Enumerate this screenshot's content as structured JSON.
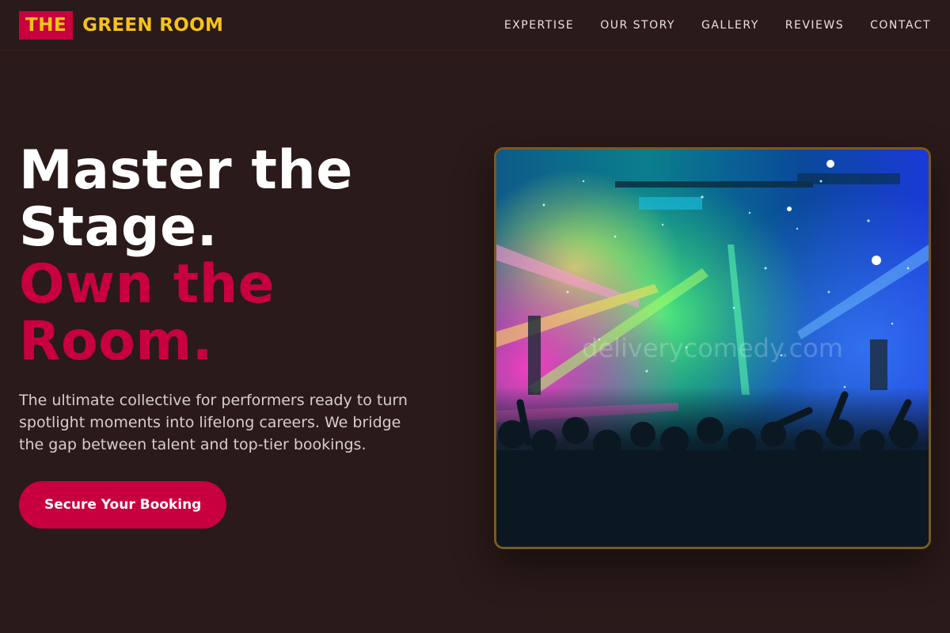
{
  "brand": {
    "mark": "THE",
    "name": "GREEN ROOM",
    "colors": {
      "accent": "#c9003e",
      "gold": "#f7c21a",
      "background": "#2a1a19"
    }
  },
  "nav": {
    "links": [
      "EXPERTISE",
      "OUR STORY",
      "GALLERY",
      "REVIEWS",
      "CONTACT"
    ]
  },
  "hero": {
    "headline_line1": "Master the Stage.",
    "headline_line2": "Own the Room.",
    "subtext": "The ultimate collective for performers ready to turn spotlight moments into lifelong careers. We bridge the gap between talent and top-tier bookings.",
    "cta_label": "Secure Your Booking"
  },
  "image": {
    "description_icon": "concert-crowd-image",
    "watermark": "deliverycomedy.com"
  }
}
